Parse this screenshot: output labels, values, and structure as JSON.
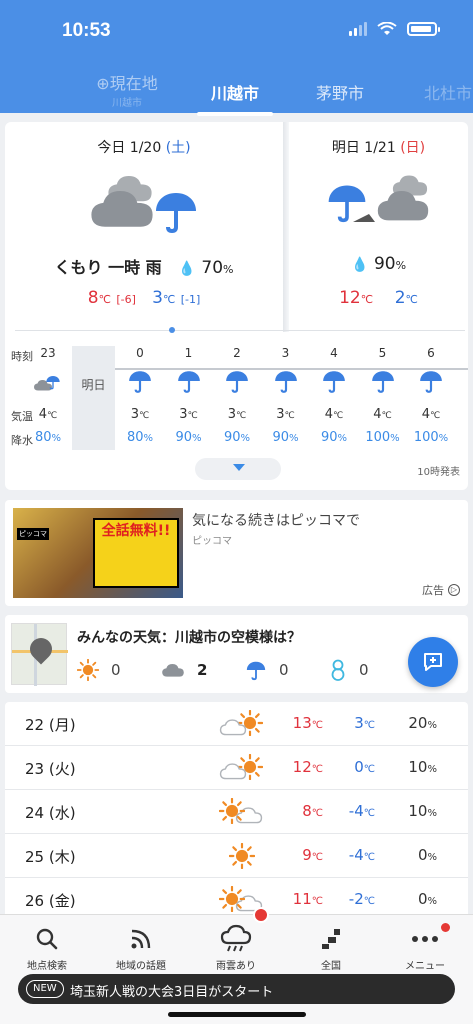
{
  "status": {
    "time": "10:53"
  },
  "tabs": {
    "current": {
      "label": "現在地",
      "sub": "川越市"
    },
    "items": [
      "川越市",
      "茅野市",
      "北杜市"
    ]
  },
  "today": {
    "label": "今日 1/20",
    "weekday": "(土)",
    "desc": "くもり 一時 雨",
    "precip": "70",
    "hi": "8",
    "hi_diff": "[-6]",
    "lo": "3",
    "lo_diff": "[-1]"
  },
  "tomorrow": {
    "label": "明日 1/21",
    "weekday": "(日)",
    "precip": "90",
    "hi": "12",
    "lo": "2"
  },
  "hourly": {
    "row_labels": {
      "hour": "時刻",
      "temp": "気温",
      "precip": "降水"
    },
    "next_day_label": "明日",
    "first": {
      "hour": "23",
      "temp": "4",
      "precip": "80"
    },
    "hours": [
      {
        "hour": "0",
        "temp": "3",
        "precip": "80"
      },
      {
        "hour": "1",
        "temp": "3",
        "precip": "90"
      },
      {
        "hour": "2",
        "temp": "3",
        "precip": "90"
      },
      {
        "hour": "3",
        "temp": "3",
        "precip": "90"
      },
      {
        "hour": "4",
        "temp": "4",
        "precip": "90"
      },
      {
        "hour": "5",
        "temp": "4",
        "precip": "100"
      },
      {
        "hour": "6",
        "temp": "4",
        "precip": "100"
      }
    ],
    "issued": "10時発表"
  },
  "units": {
    "deg": "℃",
    "pct": "%"
  },
  "ad": {
    "title": "気になる続きはピッコマで",
    "sponsor": "ピッコマ",
    "badge": "ピッコマ",
    "banner": "全話無料!!",
    "label": "広告"
  },
  "minna": {
    "title": "みんなの天気：川越市の空模様は？",
    "counts": {
      "sun": "0",
      "cloud": "2",
      "rain": "0",
      "snow": "0"
    }
  },
  "weekly": [
    {
      "date": "22 (月)",
      "icon": "cloud-sun-icon",
      "hi": "13",
      "lo": "3",
      "precip": "20"
    },
    {
      "date": "23 (火)",
      "icon": "cloud-sun-icon",
      "hi": "12",
      "lo": "0",
      "precip": "10"
    },
    {
      "date": "24 (水)",
      "icon": "sun-cloud-icon",
      "hi": "8",
      "lo": "-4",
      "precip": "10"
    },
    {
      "date": "25 (木)",
      "icon": "sun-icon",
      "hi": "9",
      "lo": "-4",
      "precip": "0"
    },
    {
      "date": "26 (金)",
      "icon": "sun-cloud-icon",
      "hi": "11",
      "lo": "-2",
      "precip": "0"
    }
  ],
  "nav": {
    "search": "地点検索",
    "topics": "地域の話題",
    "radar": "雨雲あり",
    "national": "全国",
    "menu": "メニュー"
  },
  "news": {
    "badge": "NEW",
    "text": "埼玉新人戦の大会3日目がスタート"
  },
  "colors": {
    "header": "#4b8fe6",
    "high": "#e0323c",
    "low": "#2f6fd6",
    "precip": "#3b8be6"
  }
}
